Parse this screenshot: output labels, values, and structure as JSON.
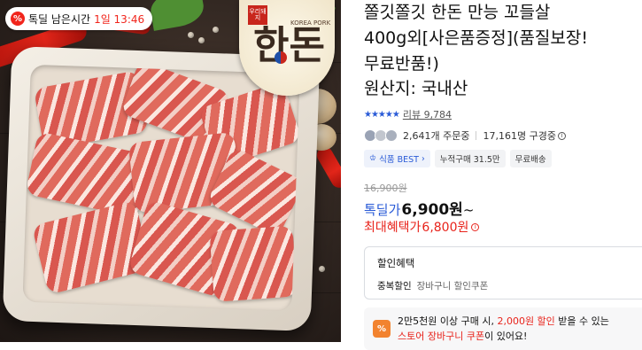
{
  "timer_badge": {
    "icon": "percent-icon",
    "label": "톡딜 남은시간",
    "time": "1일 13:46"
  },
  "brand": {
    "stamp": "우리돼지",
    "name": "한돈",
    "sub": "KOREA PORK",
    "accent_colors": [
      "#c8261c",
      "#1f4fa8"
    ]
  },
  "product": {
    "title": "쫄깃쫄깃 한돈 만능 꼬들살\n400g외[사은품증정](품질보장!\n무료반품!)",
    "origin": "원산지: 국내산"
  },
  "rating": {
    "stars": "★★★★★",
    "review_label": "리뷰 9,784"
  },
  "stats": {
    "orders": "2,641개 주문중",
    "purchases": "17,161명 구경중",
    "info_icon": "info-icon"
  },
  "tags": [
    {
      "label": "식품 BEST",
      "icon": "crown-icon",
      "suffix": "›",
      "style": "blue"
    },
    {
      "label": "누적구매 31.5만",
      "style": "gray"
    },
    {
      "label": "무료배송",
      "style": "gray"
    }
  ],
  "price": {
    "original": "16,900원",
    "deal_label": "톡딜가",
    "deal_price": "6,900원",
    "deal_suffix": "~",
    "max_label": "최대혜택가",
    "max_price": "6,800원"
  },
  "discount": {
    "title": "할인혜택",
    "kind": "중복할인",
    "desc": "장바구니 할인쿠폰"
  },
  "coupon": {
    "icon": "coupon-percent-icon",
    "line1_a": "2만5천원 이상 구매 시, ",
    "line1_hl": "2,000원 할인",
    "line1_b": " 받을 수 있는",
    "line2_hl": "스토어 장바구니 쿠폰",
    "line2_b": "이 있어요!"
  },
  "colors": {
    "accent_blue": "#2a5bd7",
    "accent_red": "#e8231b",
    "coupon_orange": "#f2832f"
  }
}
